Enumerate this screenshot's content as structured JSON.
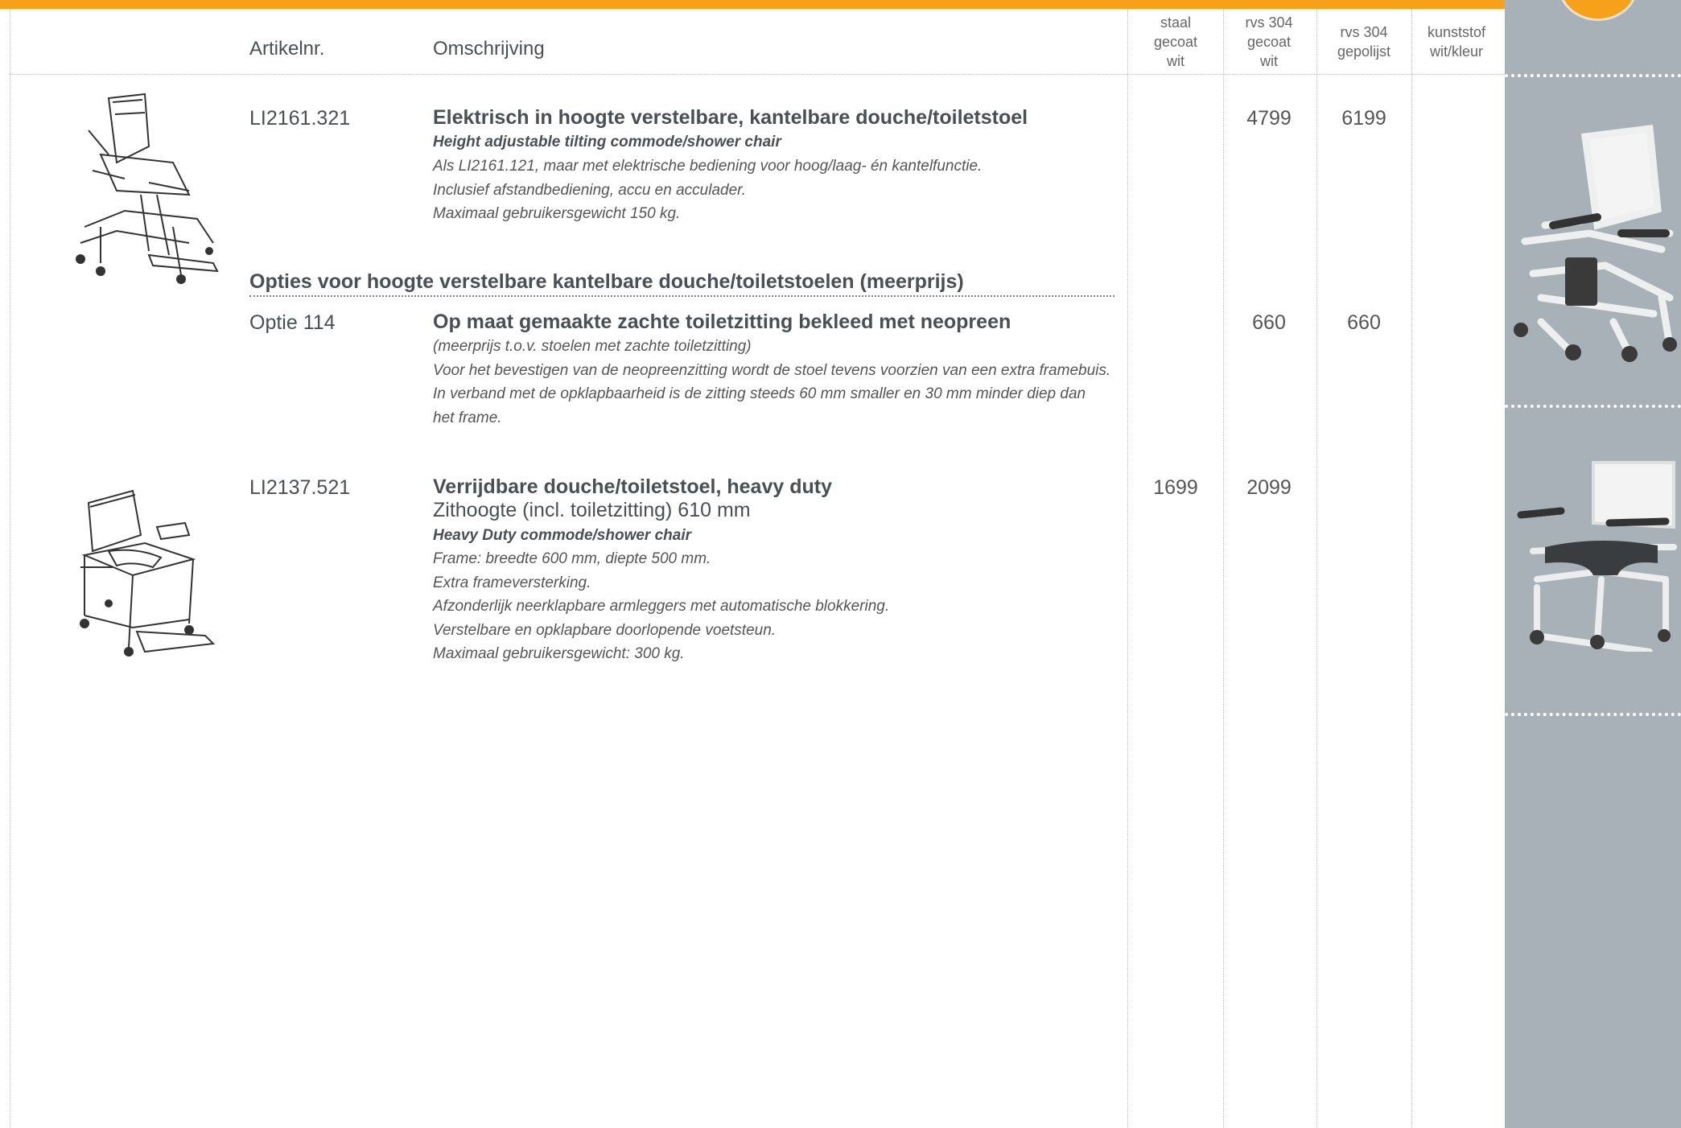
{
  "header": {
    "artikelnr_label": "Artikelnr.",
    "omschrijving_label": "Omschrijving",
    "columns": [
      {
        "line1": "staal",
        "line2": "gecoat",
        "line3": "wit"
      },
      {
        "line1": "rvs 304",
        "line2": "gecoat",
        "line3": "wit"
      },
      {
        "line1": "rvs 304",
        "line2": "gepolijst",
        "line3": ""
      },
      {
        "line1": "kunststof",
        "line2": "wit/kleur",
        "line3": ""
      }
    ]
  },
  "products": [
    {
      "article": "LI2161.321",
      "title": "Elektrisch in hoogte verstelbare, kantelbare douche/toiletstoel",
      "english": "Height adjustable tilting commode/shower chair",
      "description": [
        "Als LI2161.121, maar met elektrische bediening voor hoog/laag- én kantelfunctie.",
        "Inclusief afstandbediening, accu en acculader.",
        "Maximaal gebruikersgewicht 150 kg."
      ],
      "prices": {
        "staal": "",
        "rvs_gecoat": "4799",
        "rvs_gepolijst": "6199",
        "kunststof": ""
      }
    },
    {
      "article": "Optie 114",
      "title": "Op maat gemaakte zachte toiletzitting bekleed met neopreen",
      "description": [
        "(meerprijs t.o.v. stoelen met zachte toiletzitting)",
        "Voor het bevestigen van de neopreenzitting wordt de stoel tevens voorzien van een extra framebuis.",
        "In verband met de opklapbaarheid is de zitting steeds 60 mm smaller en 30 mm minder diep dan",
        "het frame."
      ],
      "prices": {
        "staal": "",
        "rvs_gecoat": "660",
        "rvs_gepolijst": "660",
        "kunststof": ""
      }
    },
    {
      "article": "LI2137.521",
      "title": "Verrijdbare douche/toiletstoel, heavy duty",
      "subtitle": "Zithoogte (incl. toiletzitting) 610 mm",
      "english": "Heavy Duty commode/shower chair",
      "description": [
        "Frame: breedte 600 mm, diepte 500 mm.",
        "Extra frameversterking.",
        "Afzonderlijk neerklapbare armleggers met automatische blokkering.",
        "Verstelbare en opklapbare doorlopende voetsteun.",
        "Maximaal gebruikersgewicht: 300 kg."
      ],
      "prices": {
        "staal": "1699",
        "rvs_gecoat": "2099",
        "rvs_gepolijst": "",
        "kunststof": ""
      }
    }
  ],
  "options_section_title": "Opties voor hoogte verstelbare kantelbare douche/toiletstoelen (meerprijs)",
  "colors": {
    "accent": "#f7a11a",
    "sidebar": "#a9b1b8",
    "text": "#4a4f56"
  }
}
